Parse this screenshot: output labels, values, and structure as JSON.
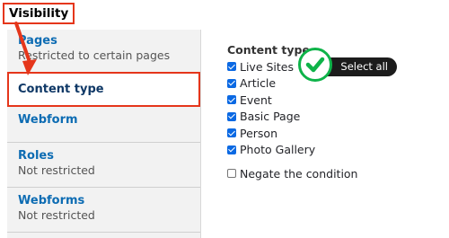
{
  "title": "Visibility",
  "tabs": [
    {
      "label": "Pages",
      "summary": "Restricted to certain pages"
    },
    {
      "label": "Content type",
      "summary": ""
    },
    {
      "label": "Webform",
      "summary": ""
    },
    {
      "label": "Roles",
      "summary": "Not restricted"
    },
    {
      "label": "Webforms",
      "summary": "Not restricted"
    }
  ],
  "content_type": {
    "heading": "Content type",
    "options": [
      {
        "label": "Live Sites",
        "checked": true
      },
      {
        "label": "Article",
        "checked": true
      },
      {
        "label": "Event",
        "checked": true
      },
      {
        "label": "Basic Page",
        "checked": true
      },
      {
        "label": "Person",
        "checked": true
      },
      {
        "label": "Photo Gallery",
        "checked": true
      }
    ],
    "negate_label": "Negate the condition",
    "negate_checked": false
  },
  "select_all_label": "Select all",
  "colors": {
    "highlight": "#e5361b",
    "link": "#0d6cb3",
    "check": "#0eb349"
  }
}
